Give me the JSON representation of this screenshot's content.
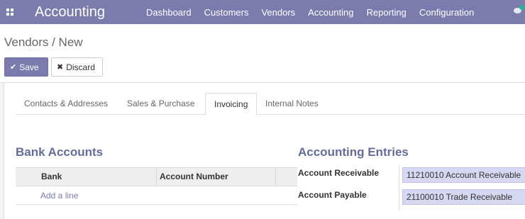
{
  "navbar": {
    "brand": "Accounting",
    "menu": [
      "Dashboard",
      "Customers",
      "Vendors",
      "Accounting",
      "Reporting",
      "Configuration"
    ],
    "colors": {
      "navbar_bg": "#7c7bad",
      "accent": "#7c7bad",
      "chat_status": "#21b799"
    },
    "icons": {
      "apps": "apps-grid-icon",
      "chat": "chat-icon"
    }
  },
  "breadcrumb": "Vendors / New",
  "buttons": {
    "save": {
      "icon": "✔",
      "label": "Save"
    },
    "discard": {
      "icon": "✖",
      "label": "Discard"
    }
  },
  "tabs": [
    "Contacts & Addresses",
    "Sales & Purchase",
    "Invoicing",
    "Internal Notes"
  ],
  "active_tab": "Invoicing",
  "bank_accounts": {
    "title": "Bank Accounts",
    "columns": [
      "Bank",
      "Account Number"
    ],
    "rows": [],
    "add_line": "Add a line"
  },
  "accounting_entries": {
    "title": "Accounting Entries",
    "fields": [
      {
        "label": "Account Receivable",
        "value": "11210010 Account Receivable"
      },
      {
        "label": "Account Payable",
        "value": "21100010 Trade Receivable"
      }
    ]
  }
}
